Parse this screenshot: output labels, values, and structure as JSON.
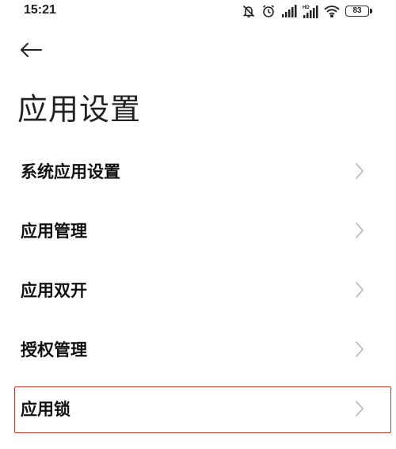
{
  "status_bar": {
    "time": "15:21",
    "battery_level": "83",
    "icons": [
      "mute-icon",
      "alarm-icon",
      "signal-icon",
      "hd-signal-icon",
      "wifi-icon",
      "battery-icon"
    ]
  },
  "header": {
    "back_icon": "arrow-left-icon",
    "title": "应用设置"
  },
  "menu": {
    "items": [
      {
        "label": "系统应用设置"
      },
      {
        "label": "应用管理"
      },
      {
        "label": "应用双开"
      },
      {
        "label": "授权管理"
      },
      {
        "label": "应用锁"
      }
    ],
    "highlight_color": "#c0392b"
  }
}
